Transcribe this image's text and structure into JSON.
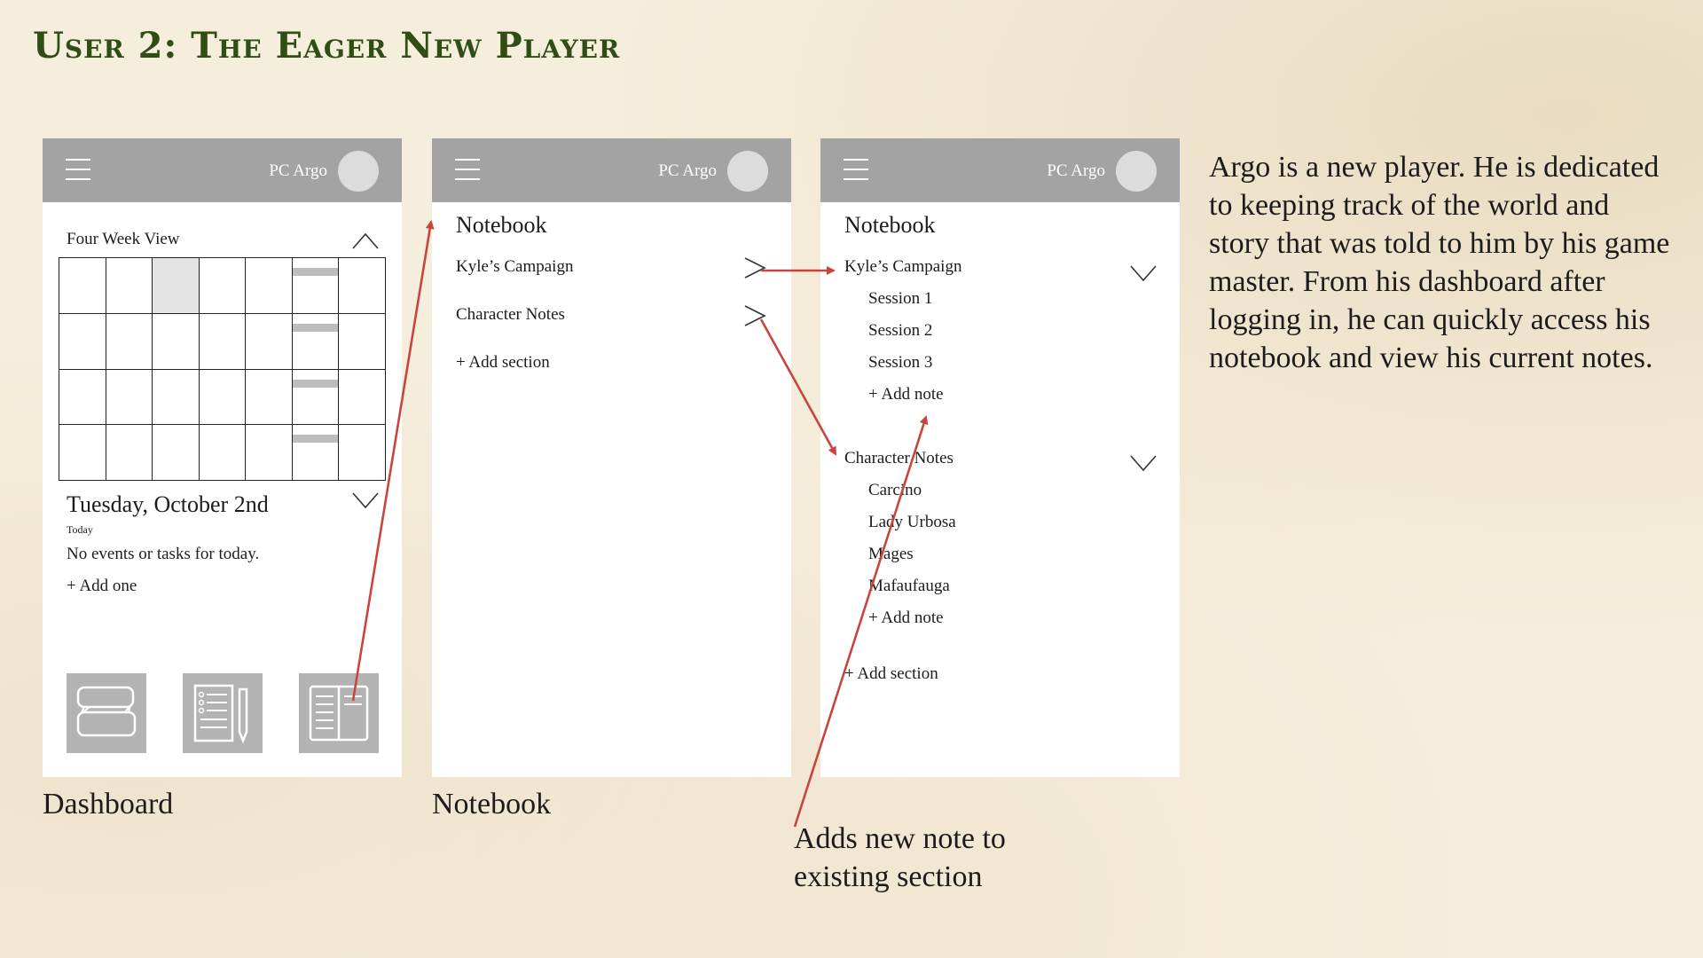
{
  "page_title": "User 2: The Eager New Player",
  "header": {
    "user_name": "PC Argo"
  },
  "dashboard": {
    "section_title": "Four Week View",
    "date": "Tuesday, October 2nd",
    "date_sub": "Today",
    "empty_message": "No events or tasks for today.",
    "add_one": "+ Add one",
    "label": "Dashboard",
    "nav_icons": [
      "chat-icon",
      "character-sheet-icon",
      "notebook-icon"
    ]
  },
  "notebook": {
    "title": "Notebook",
    "sections": [
      "Kyle’s Campaign",
      "Character Notes"
    ],
    "add_section": "+ Add section",
    "label": "Notebook"
  },
  "notebook_expanded": {
    "title": "Notebook",
    "campaign": {
      "label": "Kyle’s Campaign",
      "notes": [
        "Session 1",
        "Session 2",
        "Session 3"
      ],
      "add_note": "+ Add note"
    },
    "characters": {
      "label": "Character Notes",
      "notes": [
        "Carcino",
        "Lady Urbosa",
        "Mages",
        "Mafaufauga"
      ],
      "add_note": "+ Add note"
    },
    "add_section": "+ Add section"
  },
  "callout": {
    "line1": "Adds new note to",
    "line2": "existing section"
  },
  "description": "Argo is a new player. He is dedicated to keeping track of the world and story that was told to him by his game master. From his dashboard after logging in, he can quickly access his notebook and view his current notes.",
  "colors": {
    "background": "#f6eedd",
    "title": "#2f4d14",
    "header": "#a3a3a3",
    "arrow": "#c8453f",
    "tile": "#b3b3b3"
  }
}
